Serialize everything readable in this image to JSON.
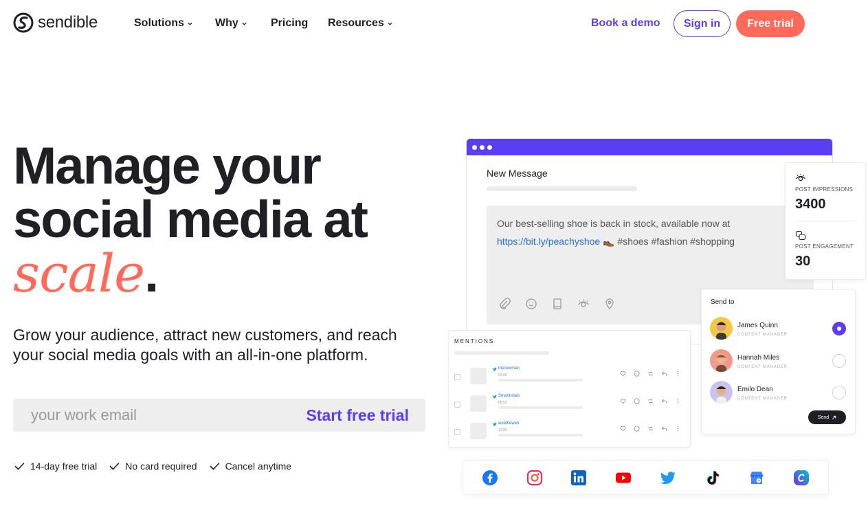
{
  "nav": {
    "brand": "sendible",
    "items": [
      {
        "label": "Solutions",
        "dropdown": true
      },
      {
        "label": "Why",
        "dropdown": true
      },
      {
        "label": "Pricing",
        "dropdown": false
      },
      {
        "label": "Resources",
        "dropdown": true
      }
    ],
    "book_demo": "Book a demo",
    "sign_in": "Sign in",
    "free_trial": "Free trial"
  },
  "hero": {
    "title_line1": "Manage your",
    "title_line2": "social media at",
    "title_accent": "scale",
    "title_period": ".",
    "subtitle": "Grow your audience, attract new customers, and reach your social media goals with an all-in-one platform.",
    "email_placeholder": "your work email",
    "cta": "Start free trial",
    "perks": [
      "14-day free trial",
      "No card required",
      "Cancel anytime"
    ]
  },
  "mockup": {
    "compose": {
      "title": "New Message",
      "text_before_link": "Our best-selling shoe is back in stock, available now at ",
      "link": "https://bit.ly/peachyshoe",
      "emoji": "👞",
      "hashtags": " #shoes #fashion #shopping"
    },
    "stats": [
      {
        "label": "POST IMPRESSIONS",
        "value": "3400",
        "icon": "eye-icon"
      },
      {
        "label": "POST ENGAGEMENT",
        "value": "30",
        "icon": "chat-icon"
      }
    ],
    "mentions": {
      "title": "MENTIONS",
      "rows": [
        {
          "handle": "thenewman",
          "time": "03:00"
        },
        {
          "handle": "Smartintials",
          "time": "05:52"
        },
        {
          "handle": "webtheweb",
          "time": "12:00"
        }
      ]
    },
    "send_to": {
      "title": "Send to",
      "people": [
        {
          "name": "James Quinn",
          "role": "CONTENT MANAGER",
          "selected": true
        },
        {
          "name": "Hannah Miles",
          "role": "CONTENT MANAGER",
          "selected": false
        },
        {
          "name": "Emilo Dean",
          "role": "CONTENT MANAGER",
          "selected": false
        }
      ],
      "send_label": "Send"
    },
    "networks": [
      "facebook-icon",
      "instagram-icon",
      "linkedin-icon",
      "youtube-icon",
      "twitter-icon",
      "tiktok-icon",
      "google-business-icon",
      "canva-icon"
    ]
  },
  "colors": {
    "brand_purple": "#5a3ef5",
    "accent_coral": "#ff6a5b",
    "text_dark": "#1f1f24"
  }
}
